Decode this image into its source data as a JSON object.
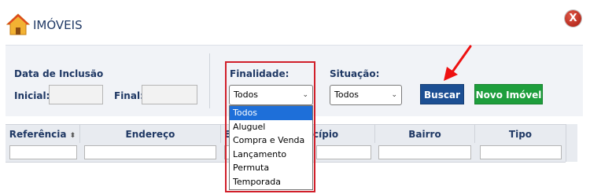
{
  "header": {
    "title": "IMÓVEIS"
  },
  "filters": {
    "data_inclusao_label": "Data de Inclusão",
    "inicial_label": "Inicial:",
    "inicial_value": "",
    "final_label": "Final:",
    "final_value": "",
    "finalidade_label": "Finalidade:",
    "finalidade_selected": "Todos",
    "finalidade_options": [
      "Todos",
      "Aluguel",
      "Compra e Venda",
      "Lançamento",
      "Permuta",
      "Temporada"
    ],
    "situacao_label": "Situação:",
    "situacao_selected": "Todos"
  },
  "buttons": {
    "buscar": "Buscar",
    "novo_imovel": "Novo Imóvel"
  },
  "grid": {
    "columns": [
      "Referência",
      "Endereço",
      "Es",
      "cípio",
      "Bairro",
      "Tipo"
    ],
    "sort_icon": "⬍"
  },
  "colors": {
    "primary_button": "#1c4f93",
    "success_button": "#1e9e3c",
    "highlight_border": "#d11f2a",
    "title_text": "#1f3864"
  }
}
